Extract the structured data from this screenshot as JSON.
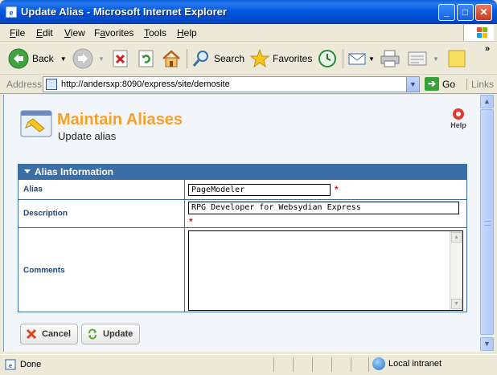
{
  "window": {
    "title": "Update Alias - Microsoft Internet Explorer",
    "minimize": "_",
    "maximize": "□",
    "close": "✕"
  },
  "menu": [
    {
      "label": "File",
      "key": "F",
      "rest": "ile"
    },
    {
      "label": "Edit",
      "key": "E",
      "rest": "dit"
    },
    {
      "label": "View",
      "key": "V",
      "rest": "iew"
    },
    {
      "label": "Favorites",
      "key": "a",
      "pre": "F",
      "rest": "vorites"
    },
    {
      "label": "Tools",
      "key": "T",
      "rest": "ools"
    },
    {
      "label": "Help",
      "key": "H",
      "rest": "elp"
    }
  ],
  "toolbar": {
    "back_label": "Back",
    "search_label": "Search",
    "favorites_label": "Favorites"
  },
  "address": {
    "label": "Address",
    "url": "http://andersxp:8090/express/site/demosite",
    "go_label": "Go",
    "links_label": "Links"
  },
  "page": {
    "title": "Maintain Aliases",
    "subtitle": "Update alias",
    "help_label": "Help",
    "panel_title": "Alias Information",
    "fields": {
      "alias_label": "Alias",
      "alias_value": "PageModeler",
      "description_label": "Description",
      "description_value": "RPG Developer for Websydian Express",
      "comments_label": "Comments",
      "comments_value": "",
      "required_marker": "*"
    },
    "cancel_label": "Cancel",
    "update_label": "Update"
  },
  "status": {
    "text": "Done",
    "zone": "Local intranet"
  },
  "colors": {
    "title_accent": "#f7a12a",
    "panel_header": "#3a6ea5",
    "required": "#e02020"
  }
}
